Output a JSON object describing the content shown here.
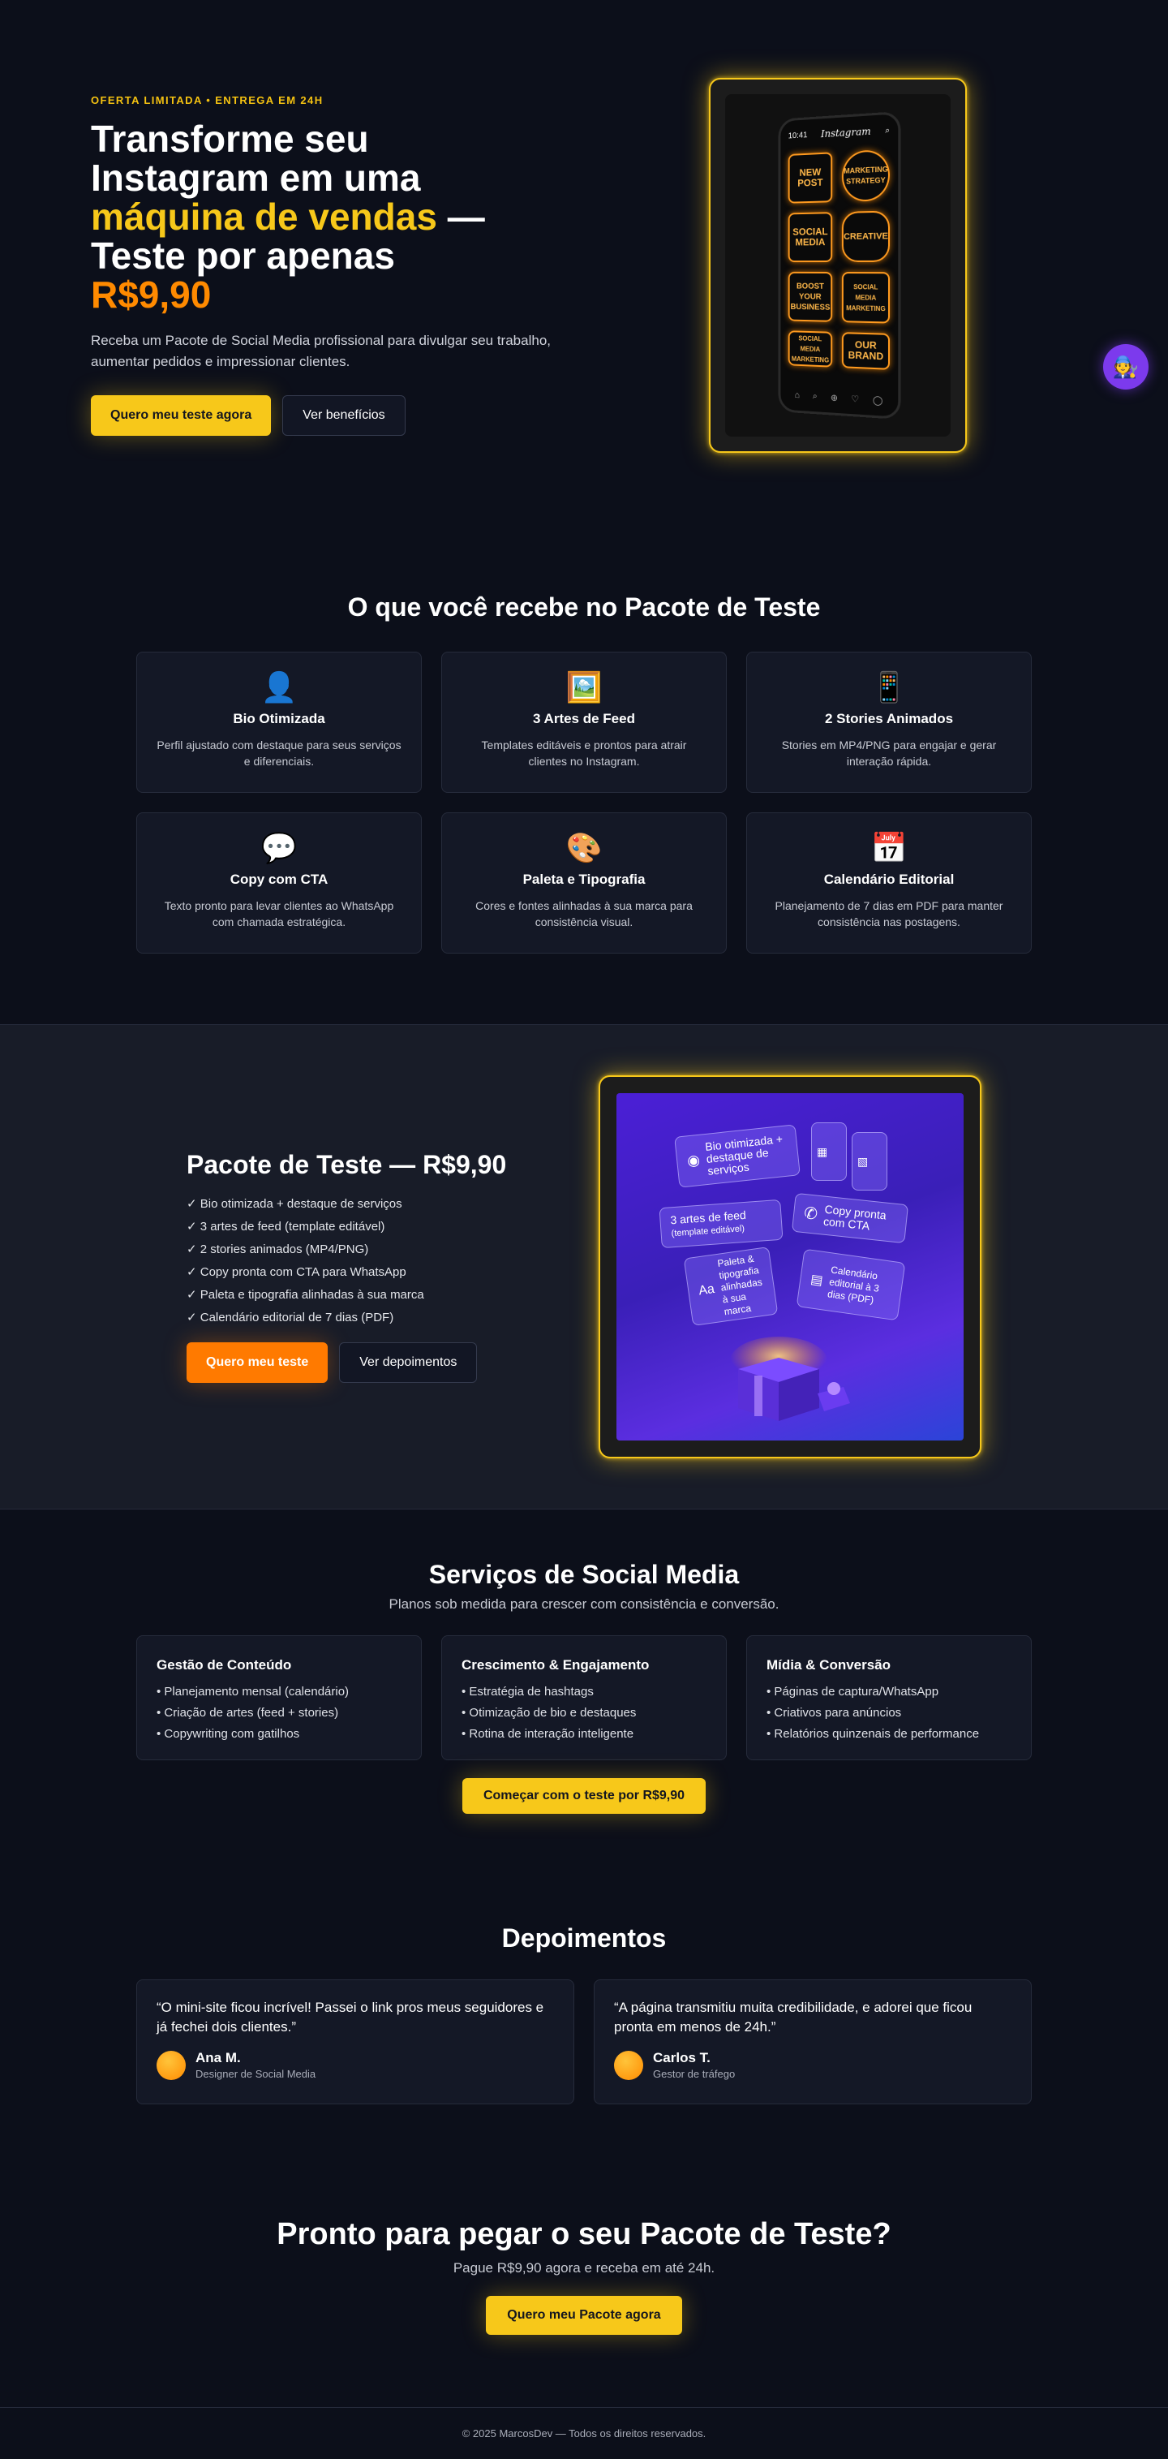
{
  "hero": {
    "eyebrow": "OFERTA LIMITADA • ENTREGA EM 24H",
    "headline_1": "Transforme seu",
    "headline_2": "Instagram em uma",
    "headline_highlight": "máquina de vendas",
    "headline_dash": " —",
    "headline_3": "Teste por apenas",
    "headline_price": "R$9,90",
    "lead": "Receba um Pacote de Social Media profissional para divulgar seu trabalho, aumentar pedidos e impressionar clientes.",
    "primary_cta": "Quero meu teste agora",
    "secondary_cta": "Ver benefícios",
    "phone": {
      "time": "10:41",
      "app_name": "Instagram",
      "tiles": [
        "NEW POST",
        "MARKETING STRATEGY",
        "SOCIAL MEDIA",
        "CREATIVE",
        "BOOST YOUR BUSINESS",
        "SOCIAL MEDIA MARKETING",
        "SOCIAL MEDIA MARKETING",
        "OUR BRAND"
      ]
    }
  },
  "recebe": {
    "title": "O que você recebe no Pacote de Teste",
    "items": [
      {
        "icon": "person-silhouette",
        "glyph": "👤",
        "title": "Bio Otimizada",
        "desc": "Perfil ajustado com destaque para seus serviços e diferenciais."
      },
      {
        "icon": "framed-picture",
        "glyph": "🖼️",
        "title": "3 Artes de Feed",
        "desc": "Templates editáveis e prontos para atrair clientes no Instagram."
      },
      {
        "icon": "mobile-phone",
        "glyph": "📱",
        "title": "2 Stories Animados",
        "desc": "Stories em MP4/PNG para engajar e gerar interação rápida."
      },
      {
        "icon": "speech-balloon",
        "glyph": "💬",
        "title": "Copy com CTA",
        "desc": "Texto pronto para levar clientes ao WhatsApp com chamada estratégica."
      },
      {
        "icon": "artist-palette",
        "glyph": "🎨",
        "title": "Paleta e Tipografia",
        "desc": "Cores e fontes alinhadas à sua marca para consistência visual."
      },
      {
        "icon": "calendar",
        "glyph": "📅",
        "title": "Calendário Editorial",
        "desc": "Planejamento de 7 dias em PDF para manter consistência nas postagens."
      }
    ]
  },
  "pacote": {
    "title": "Pacote de Teste — R$9,90",
    "items": [
      "✓ Bio otimizada + destaque de serviços",
      "✓ 3 artes de feed (template editável)",
      "✓ 2 stories animados (MP4/PNG)",
      "✓ Copy pronta com CTA para WhatsApp",
      "✓ Paleta e tipografia alinhadas à sua marca",
      "✓ Calendário editorial de 7 dias (PDF)"
    ],
    "primary_cta": "Quero meu teste",
    "secondary_cta": "Ver depoimentos",
    "promo_cards": {
      "bio": "Bio otimizada + destaque de serviços",
      "feed": "3 artes de feed",
      "feed_note": "(template editável)",
      "copy": "Copy pronta com CTA",
      "paleta": "Paleta & tipografia alinhadas à sua marca",
      "calendario": "Calendário editorial à 3 dias (PDF)"
    }
  },
  "servicos": {
    "title": "Serviços de Social Media",
    "subtitle": "Planos sob medida para crescer com consistência e conversão.",
    "columns": [
      {
        "title": "Gestão de Conteúdo",
        "items": [
          "• Planejamento mensal (calendário)",
          "• Criação de artes (feed + stories)",
          "• Copywriting com gatilhos"
        ]
      },
      {
        "title": "Crescimento & Engajamento",
        "items": [
          "• Estratégia de hashtags",
          "• Otimização de bio e destaques",
          "• Rotina de interação inteligente"
        ]
      },
      {
        "title": "Mídia & Conversão",
        "items": [
          "• Páginas de captura/WhatsApp",
          "• Criativos para anúncios",
          "• Relatórios quinzenais de performance"
        ]
      }
    ],
    "cta": "Começar com o teste por R$9,90"
  },
  "depoimentos": {
    "title": "Depoimentos",
    "items": [
      {
        "quote": "“O mini-site ficou incrível! Passei o link pros meus seguidores e já fechei dois clientes.”",
        "name": "Ana M.",
        "role": "Designer de Social Media"
      },
      {
        "quote": "“A página transmitiu muita credibilidade, e adorei que ficou pronta em menos de 24h.”",
        "name": "Carlos T.",
        "role": "Gestor de tráfego"
      }
    ]
  },
  "final_cta": {
    "title": "Pronto para pegar o seu Pacote de Teste?",
    "subtitle": "Pague R$9,90 agora e receba em até 24h.",
    "button": "Quero meu Pacote agora"
  },
  "footer": {
    "text": "© 2025 MarcosDev — Todos os direitos reservados."
  },
  "floating_avatar": {
    "icon": "mechanic-avatar",
    "glyph": "🧑‍🔧"
  },
  "colors": {
    "background": "#0c0f1a",
    "accent_yellow": "#f7c81a",
    "accent_orange": "#ff7a00",
    "card": "#141826",
    "promo_purple": "#4b1fd6"
  }
}
